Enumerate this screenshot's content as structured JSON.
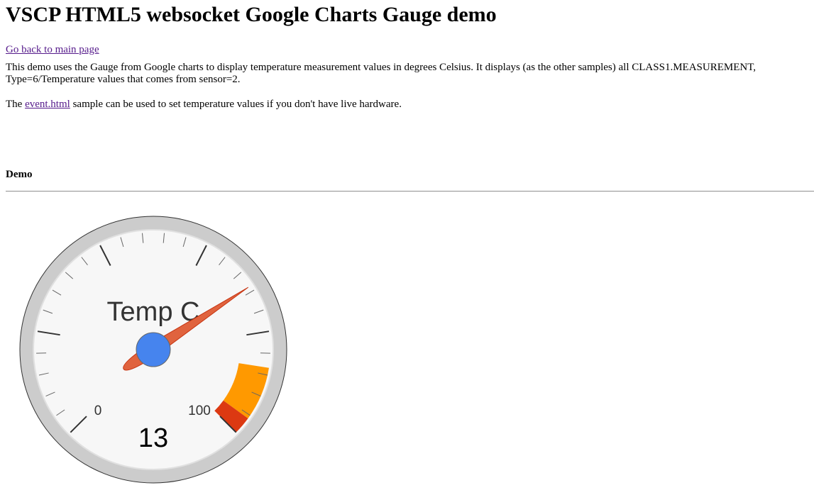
{
  "page": {
    "title": "VSCP HTML5 websocket Google Charts Gauge demo",
    "back_link": "Go back to main page",
    "description": "This demo uses the Gauge from Google charts to display temperature measurement values in degrees Celsius. It displays (as the other samples) all CLASS1.MEASUREMENT, Type=6/Temperature values that comes from sensor=2.",
    "event_note_prefix": "The ",
    "event_note_link": "event.html",
    "event_note_suffix": " sample can be used to set temperature values if you don't have live hardware.",
    "demo_heading": "Demo"
  },
  "gauge": {
    "label": "Temp C",
    "value": 13,
    "value_text": "13",
    "min": -200,
    "max": 100,
    "min_label": "0",
    "max_label": "100",
    "yellow_from": 60,
    "yellow_to": 90,
    "red_from": 90,
    "red_to": 100,
    "major_ticks": 6,
    "minor_ticks": 5,
    "colors": {
      "yellow": "#FF9900",
      "red": "#DC3912",
      "needle": "#E0633E",
      "hub": "#4684EE",
      "face": "#F7F7F7",
      "rim": "#CCCCCC",
      "tick": "#333333"
    }
  }
}
